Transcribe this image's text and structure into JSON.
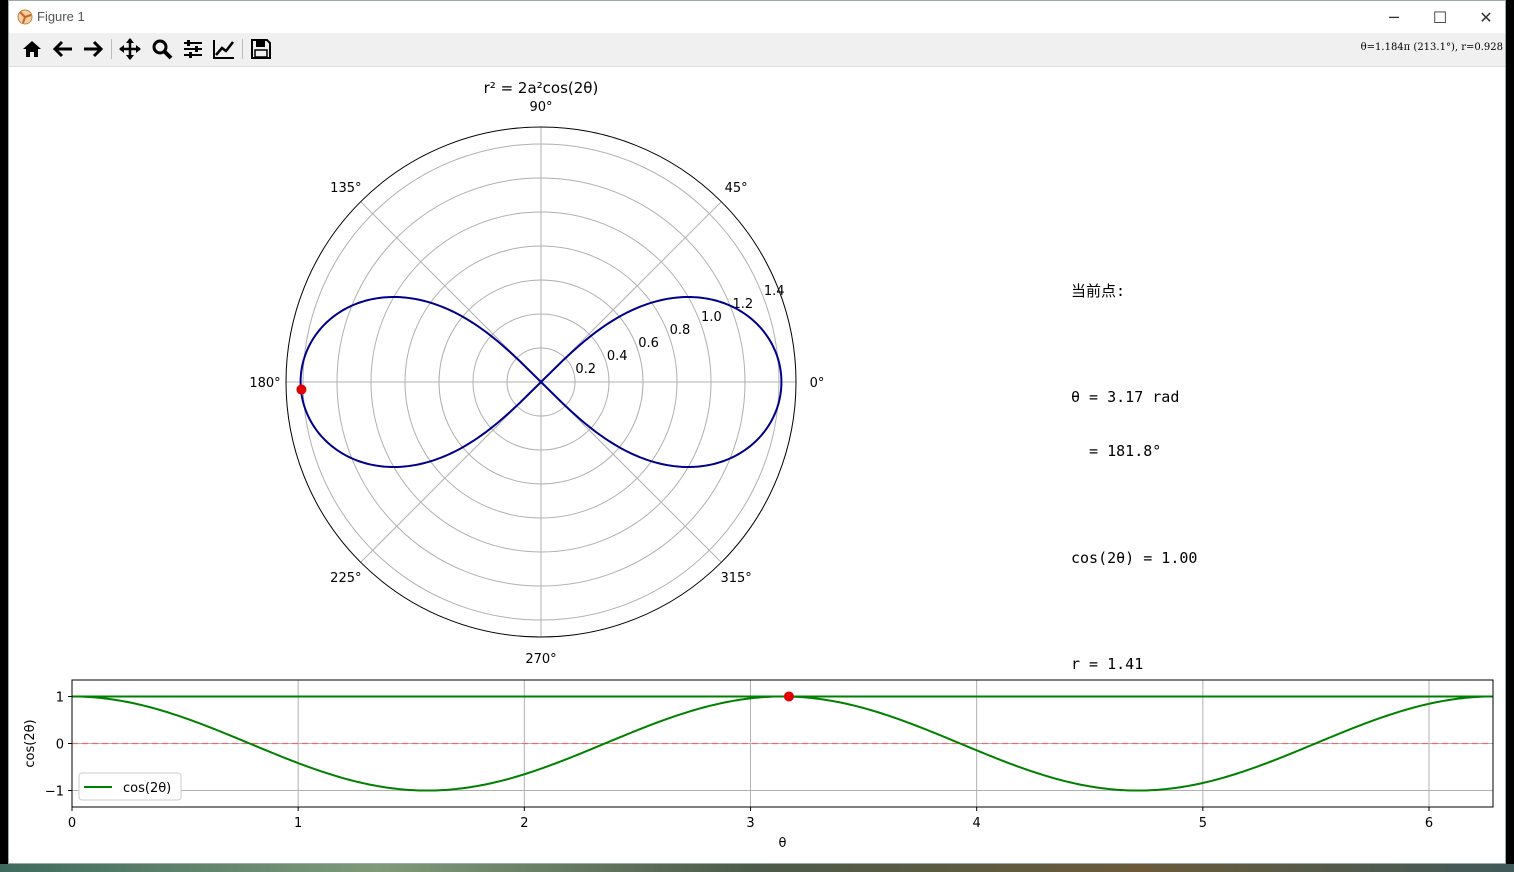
{
  "window": {
    "title": "Figure 1",
    "minimize": "─",
    "maximize": "☐",
    "close": "✕"
  },
  "toolbar": {
    "buttons": [
      "home-icon",
      "back-icon",
      "forward-icon",
      "pan-icon",
      "zoom-icon",
      "configure-icon",
      "edit-axis-icon",
      "save-icon"
    ],
    "coordinates": "θ=1.184π (213.1°), r=0.928"
  },
  "info_panel": {
    "heading": "当前点:",
    "theta_rad": "θ = 3.17 rad",
    "theta_deg": "  = 181.8°",
    "cos_line": "cos(2θ) = 1.00",
    "r_line": "r = 1.41"
  },
  "colors": {
    "curve": "#00008b",
    "marker": "#e00000",
    "cos_line": "#008000",
    "zero_line": "#e07070"
  },
  "chart_data": [
    {
      "type": "line",
      "subtype": "polar",
      "title": "r² = 2a²cos(2θ)",
      "a": 1,
      "theta_ticks": [
        "0°",
        "45°",
        "90°",
        "135°",
        "180°",
        "225°",
        "270°",
        "315°"
      ],
      "r_ticks": [
        "0.2",
        "0.4",
        "0.6",
        "0.8",
        "1.0",
        "1.2",
        "1.4"
      ],
      "rlim": [
        0,
        1.5
      ],
      "grid": true,
      "series": [
        {
          "formula": "r = sqrt(2·cos(2θ))"
        }
      ],
      "highlight_point": {
        "theta_deg": 181.8,
        "r": 1.41
      }
    },
    {
      "type": "line",
      "xlabel": "θ",
      "ylabel": "cos(2θ)",
      "xlim": [
        0,
        6.283
      ],
      "ylim": [
        -1.35,
        1.35
      ],
      "x_ticks": [
        "0",
        "1",
        "2",
        "3",
        "4",
        "5",
        "6"
      ],
      "y_ticks": [
        "1",
        "0",
        "−1"
      ],
      "grid": true,
      "legend": "bottom-left",
      "series": [
        {
          "name": "cos(2θ)",
          "formula": "cos(2θ)"
        }
      ],
      "flat_line_y": 1,
      "zero_line_y": 0,
      "highlight_point": {
        "x": 3.17,
        "y": 1.0
      }
    }
  ]
}
